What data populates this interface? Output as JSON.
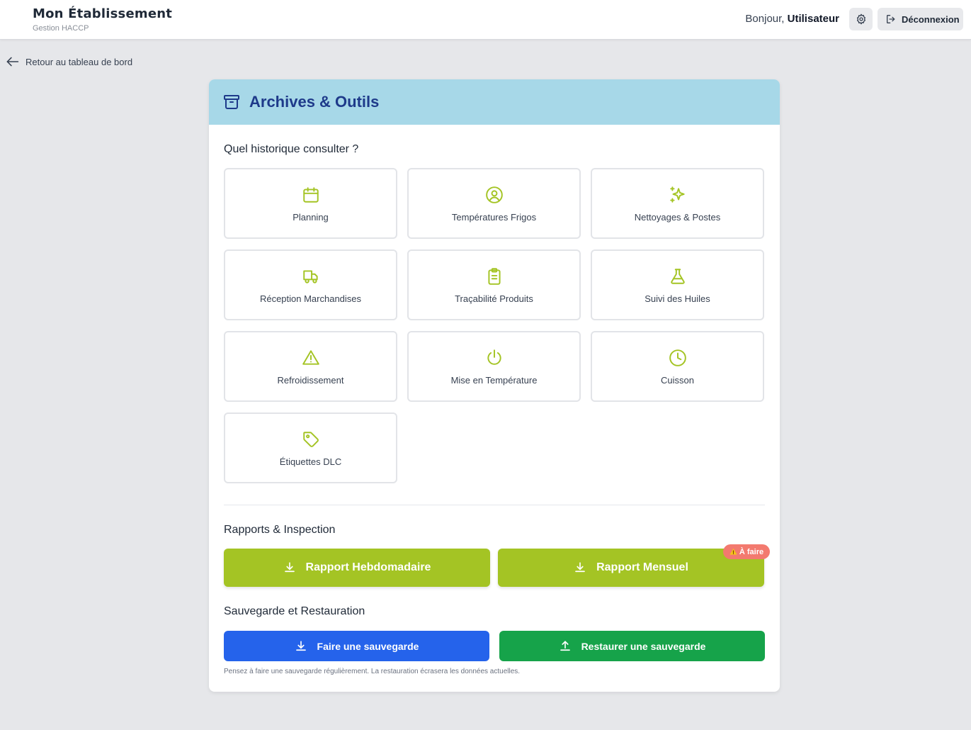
{
  "header": {
    "title": "Mon Établissement",
    "subtitle": "Gestion HACCP",
    "greeting_prefix": "Bonjour,",
    "user": "Utilisateur",
    "logout_label": "Déconnexion"
  },
  "nav": {
    "back_label": "Retour au tableau de bord"
  },
  "card": {
    "title": "Archives & Outils",
    "history_title": "Quel historique consulter ?",
    "tiles": [
      {
        "label": "Planning",
        "icon": "calendar-icon"
      },
      {
        "label": "Températures Frigos",
        "icon": "user-circle-icon"
      },
      {
        "label": "Nettoyages & Postes",
        "icon": "sparkles-icon"
      },
      {
        "label": "Réception Marchandises",
        "icon": "truck-icon"
      },
      {
        "label": "Traçabilité Produits",
        "icon": "clipboard-icon"
      },
      {
        "label": "Suivi des Huiles",
        "icon": "flask-icon"
      },
      {
        "label": "Refroidissement",
        "icon": "warning-icon"
      },
      {
        "label": "Mise en Température",
        "icon": "power-icon"
      },
      {
        "label": "Cuisson",
        "icon": "clock-icon"
      },
      {
        "label": "Étiquettes DLC",
        "icon": "tag-icon"
      }
    ],
    "reports_title": "Rapports & Inspection",
    "weekly_report_label": "Rapport Hebdomadaire",
    "monthly_report_label": "Rapport Mensuel",
    "todo_badge": "À faire",
    "backup_title": "Sauvegarde et Restauration",
    "backup_label": "Faire une sauvegarde",
    "restore_label": "Restaurer une sauvegarde",
    "backup_note": "Pensez à faire une sauvegarde régulièrement. La restauration écrasera les données actuelles."
  },
  "colors": {
    "accent_lime": "#a4c424",
    "header_band": "#a7d8e8",
    "title_blue": "#1e3a8a",
    "backup_blue": "#2563eb",
    "restore_green": "#16a34a",
    "badge_red": "#f37a6f"
  }
}
